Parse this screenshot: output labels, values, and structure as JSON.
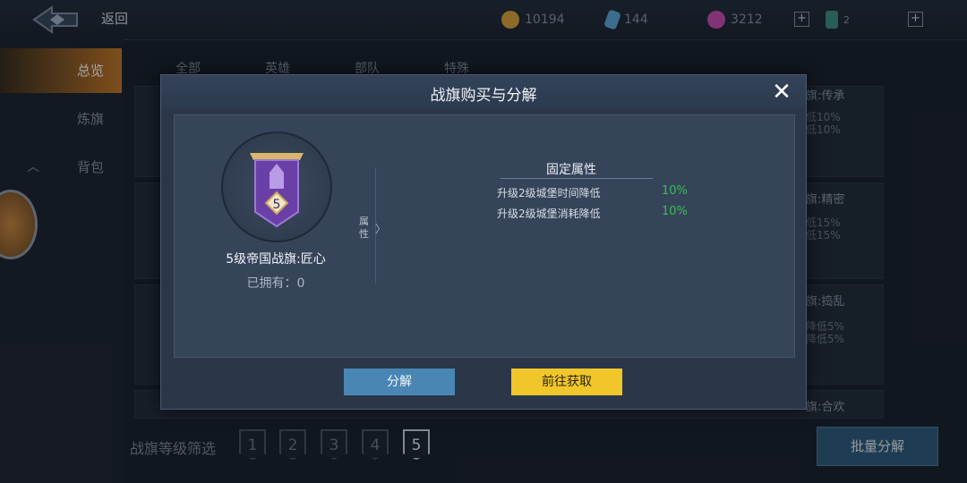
{
  "topbar": {
    "back_label": "返回",
    "resources": [
      {
        "name": "gold",
        "value": "10194",
        "color": "#d9a441"
      },
      {
        "name": "crystal",
        "value": "144",
        "color": "#5fa8d8"
      },
      {
        "name": "gem",
        "value": "3212",
        "color": "#c84fb8"
      }
    ],
    "ticket_count": "2",
    "plus_label": "+"
  },
  "sidebar": {
    "items": [
      {
        "label": "总览"
      },
      {
        "label": "炼旗"
      },
      {
        "label": "背包"
      }
    ]
  },
  "tabs": [
    {
      "label": "全部"
    },
    {
      "label": "英雄"
    },
    {
      "label": "部队"
    },
    {
      "label": "特殊"
    }
  ],
  "background_cards": [
    {
      "title": "旗:传承",
      "line1": "低10%",
      "line2": "低10%"
    },
    {
      "title": "旗:精密",
      "line1": "低15%",
      "line2": "低15%"
    },
    {
      "title": "旗:捣乱",
      "line1": "降低5%",
      "line2": "降低5%"
    },
    {
      "title": "旗:合欢",
      "line1": "",
      "line2": ""
    }
  ],
  "filter": {
    "label": "战旗等级筛选",
    "levels": [
      "1",
      "2",
      "3",
      "4",
      "5"
    ],
    "selected": "5"
  },
  "batch_button": "批量分解",
  "modal": {
    "title": "战旗购买与分解",
    "close_label": "✕",
    "flag_level": "5",
    "flag_name": "5级帝国战旗:匠心",
    "owned": "已拥有：0",
    "attr_tab": "属性",
    "attr_chevron": "〉",
    "fixed_title": "固定属性",
    "attributes": [
      {
        "label": "升级2级城堡时间降低",
        "value": "10%"
      },
      {
        "label": "升级2级城堡消耗降低",
        "value": "10%"
      }
    ],
    "decompose_button": "分解",
    "obtain_button": "前往获取"
  }
}
